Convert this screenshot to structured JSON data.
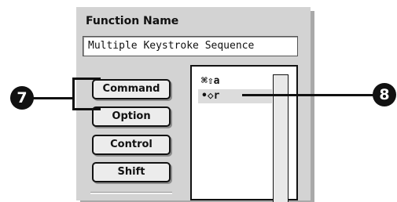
{
  "function_name": {
    "label": "Function Name",
    "value": "Multiple Keystroke Sequence"
  },
  "modifiers": [
    {
      "label": "Command"
    },
    {
      "label": "Option"
    },
    {
      "label": "Control"
    },
    {
      "label": "Shift"
    }
  ],
  "sequence": [
    {
      "text": "⌘⇧a",
      "selected": false
    },
    {
      "text": "•◇r",
      "selected": true
    }
  ],
  "callouts": [
    {
      "number": "7"
    },
    {
      "number": "8"
    }
  ]
}
